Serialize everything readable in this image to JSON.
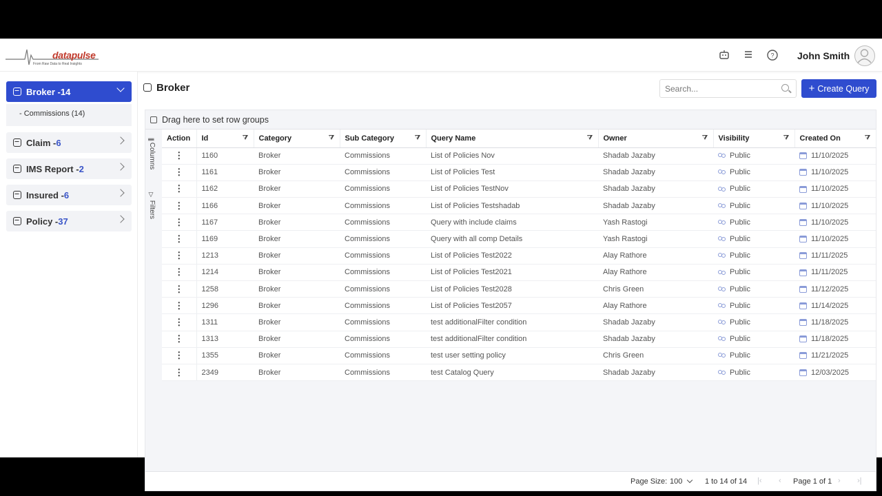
{
  "header": {
    "logo_text": "datapulse",
    "logo_tagline": "From Raw Data to Real Insights",
    "icons": [
      "robot-icon",
      "menu-icon",
      "help-icon"
    ],
    "user_name": "John Smith"
  },
  "sidebar": {
    "items": [
      {
        "label": "Broker -",
        "count": "14",
        "active": true
      },
      {
        "label": "Claim -",
        "count": "6",
        "active": false
      },
      {
        "label": "IMS Report -",
        "count": "2",
        "active": false
      },
      {
        "label": "Insured -",
        "count": "6",
        "active": false
      },
      {
        "label": "Policy -",
        "count": "37",
        "active": false
      }
    ],
    "sub_item": "- Commissions (14)"
  },
  "main": {
    "title": "Broker",
    "search_placeholder": "Search...",
    "create_label": "Create Query"
  },
  "grid": {
    "group_bar": "Drag here to set row groups",
    "tool_columns": "Columns",
    "tool_filters": "Filters",
    "columns": [
      "Action",
      "Id",
      "Category",
      "Sub Category",
      "Query Name",
      "Owner",
      "Visibility",
      "Created On"
    ],
    "rows": [
      [
        "1160",
        "Broker",
        "Commissions",
        "List of Policies Nov",
        "Shadab Jazaby",
        "Public",
        "11/10/2025"
      ],
      [
        "1161",
        "Broker",
        "Commissions",
        "List of Policies Test",
        "Shadab Jazaby",
        "Public",
        "11/10/2025"
      ],
      [
        "1162",
        "Broker",
        "Commissions",
        "List of Policies TestNov",
        "Shadab Jazaby",
        "Public",
        "11/10/2025"
      ],
      [
        "1166",
        "Broker",
        "Commissions",
        "List of Policies Testshadab",
        "Shadab Jazaby",
        "Public",
        "11/10/2025"
      ],
      [
        "1167",
        "Broker",
        "Commissions",
        "Query with include claims",
        "Yash Rastogi",
        "Public",
        "11/10/2025"
      ],
      [
        "1169",
        "Broker",
        "Commissions",
        "Query with all comp Details",
        "Yash Rastogi",
        "Public",
        "11/10/2025"
      ],
      [
        "1213",
        "Broker",
        "Commissions",
        "List of Policies Test2022",
        "Alay Rathore",
        "Public",
        "11/11/2025"
      ],
      [
        "1214",
        "Broker",
        "Commissions",
        "List of Policies Test2021",
        "Alay Rathore",
        "Public",
        "11/11/2025"
      ],
      [
        "1258",
        "Broker",
        "Commissions",
        "List of Policies Test2028",
        "Chris Green",
        "Public",
        "11/12/2025"
      ],
      [
        "1296",
        "Broker",
        "Commissions",
        "List of Policies Test2057",
        "Alay Rathore",
        "Public",
        "11/14/2025"
      ],
      [
        "1311",
        "Broker",
        "Commissions",
        "test additionalFilter condition",
        "Shadab Jazaby",
        "Public",
        "11/18/2025"
      ],
      [
        "1313",
        "Broker",
        "Commissions",
        "test additionalFilter condition",
        "Shadab Jazaby",
        "Public",
        "11/18/2025"
      ],
      [
        "1355",
        "Broker",
        "Commissions",
        "test user setting policy",
        "Chris Green",
        "Public",
        "11/21/2025"
      ],
      [
        "2349",
        "Broker",
        "Commissions",
        "test Catalog Query",
        "Shadab Jazaby",
        "Public",
        "12/03/2025"
      ]
    ]
  },
  "pager": {
    "page_size_label": "Page Size:",
    "page_size_value": "100",
    "range_text": "1 to 14 of 14",
    "page_text": "Page 1 of 1"
  },
  "colors": {
    "accent": "#2f4ccf",
    "count": "#3a55c8"
  }
}
